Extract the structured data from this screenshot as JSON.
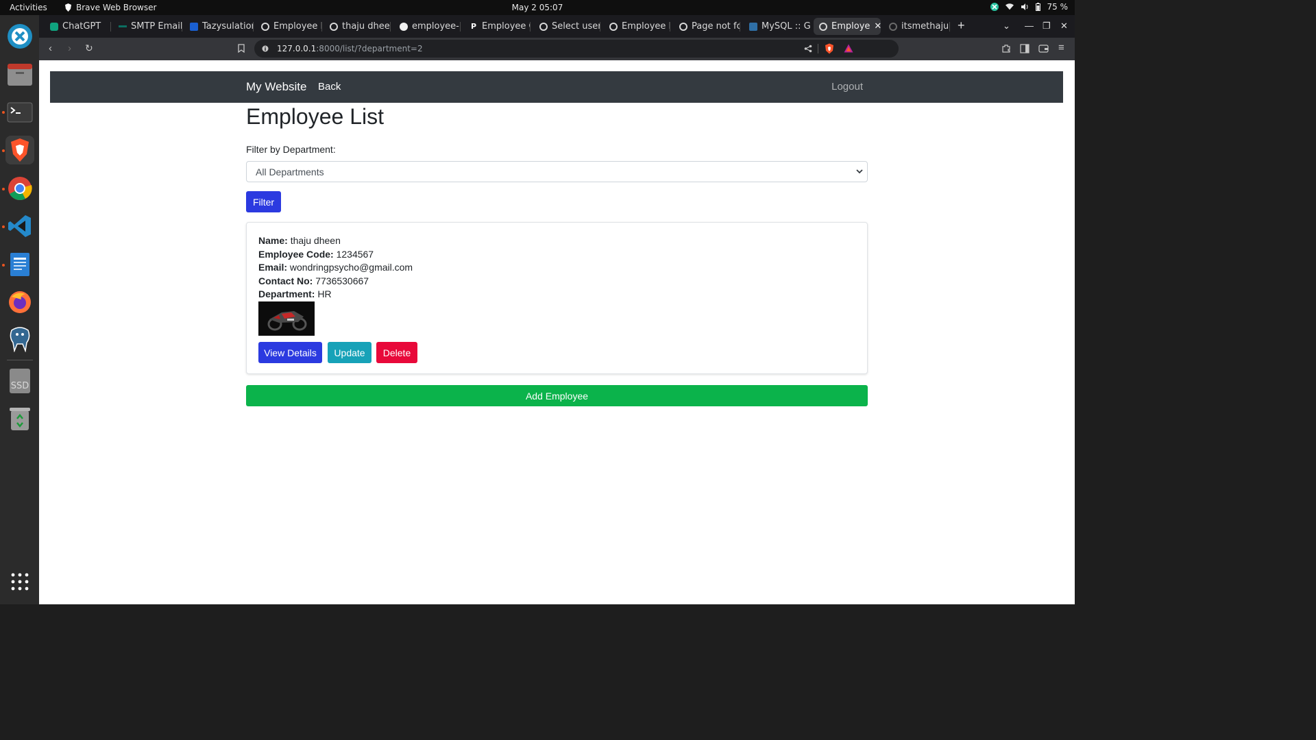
{
  "topbar": {
    "activities": "Activities",
    "app_name": "Brave Web Browser",
    "clock": "May 2  05:07",
    "battery": "75 %"
  },
  "dock": {
    "items": [
      "ubuntu-software-icon",
      "files-icon",
      "terminal-icon",
      "brave-icon",
      "chrome-icon",
      "vscode-icon",
      "libreoffice-writer-icon",
      "firefox-icon",
      "pgadmin-icon",
      "ssd-drive-icon",
      "trash-icon",
      "app-grid-icon"
    ],
    "ssd_label": "SSD"
  },
  "browser": {
    "tabs": [
      {
        "label": "ChatGPT"
      },
      {
        "label": "SMTP Email"
      },
      {
        "label": "Tazysulation"
      },
      {
        "label": "Employee D"
      },
      {
        "label": "thaju dheen"
      },
      {
        "label": "employee-m"
      },
      {
        "label": "Employee C"
      },
      {
        "label": "Select user"
      },
      {
        "label": "Employee L"
      },
      {
        "label": "Page not fo"
      },
      {
        "label": "MySQL :: Ge"
      },
      {
        "label": "Employe"
      },
      {
        "label": "itsmethaju/"
      }
    ],
    "url_host": "127.0.0.1",
    "url_rest": ":8000/list/?department=2"
  },
  "page": {
    "navbar": {
      "brand": "My Website",
      "back": "Back",
      "logout": "Logout"
    },
    "title": "Employee List",
    "filter_label": "Filter by Department:",
    "department_select": "All Departments",
    "filter_button": "Filter",
    "employee": {
      "name_label": "Name:",
      "name": "thaju dheen",
      "code_label": "Employee Code:",
      "code": "1234567",
      "email_label": "Email:",
      "email": "wondringpsycho@gmail.com",
      "contact_label": "Contact No:",
      "contact": "7736530667",
      "department_label": "Department:",
      "department": "HR"
    },
    "buttons": {
      "view": "View Details",
      "update": "Update",
      "delete": "Delete",
      "add": "Add Employee"
    }
  }
}
